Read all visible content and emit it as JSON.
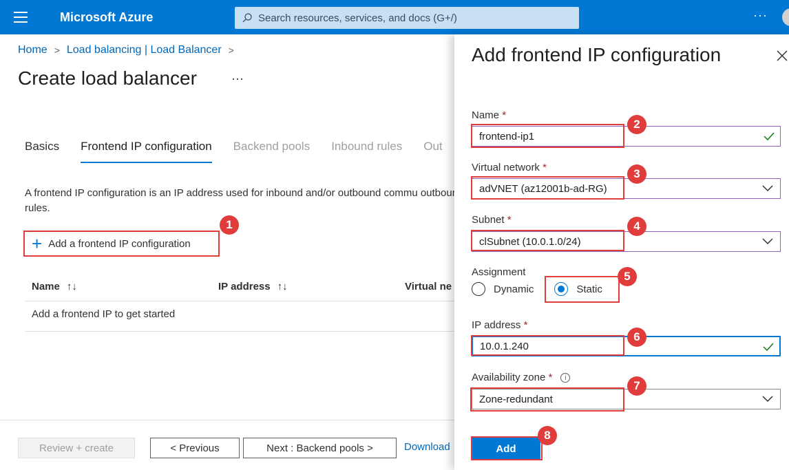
{
  "topbar": {
    "brand": "Microsoft Azure",
    "search_placeholder": "Search resources, services, and docs (G+/)",
    "more": "···"
  },
  "breadcrumb": {
    "home": "Home",
    "load_balancing": "Load balancing | Load Balancer"
  },
  "page": {
    "title": "Create load balancer",
    "more": "···"
  },
  "tabs": [
    {
      "label": "Basics"
    },
    {
      "label": "Frontend IP configuration"
    },
    {
      "label": "Backend pools"
    },
    {
      "label": "Inbound rules"
    },
    {
      "label": "Out"
    }
  ],
  "description": "A frontend IP configuration is an IP address used for inbound and/or outbound commu outbound rules.",
  "add_frontend_label": "Add a frontend IP configuration",
  "table": {
    "columns": [
      {
        "label": "Name",
        "sort": "↑↓"
      },
      {
        "label": "IP address",
        "sort": "↑↓"
      },
      {
        "label": "Virtual ne"
      }
    ],
    "empty_text": "Add a frontend IP to get started"
  },
  "footer": {
    "review_create": "Review + create",
    "previous": "< Previous",
    "next": "Next : Backend pools >",
    "download": "Download"
  },
  "panel": {
    "title": "Add frontend IP configuration",
    "name_label": "Name",
    "name_value": "frontend-ip1",
    "vnet_label": "Virtual network",
    "vnet_value": "adVNET (az12001b-ad-RG)",
    "subnet_label": "Subnet",
    "subnet_value": "clSubnet (10.0.1.0/24)",
    "assignment_label": "Assignment",
    "assignment_options": [
      "Dynamic",
      "Static"
    ],
    "assignment_selected": "Static",
    "ip_label": "IP address",
    "ip_value": "10.0.1.240",
    "zone_label": "Availability zone",
    "zone_value": "Zone-redundant",
    "required_mark": "*",
    "info_mark": "i",
    "add_button": "Add"
  },
  "step_badges": [
    "1",
    "2",
    "3",
    "4",
    "5",
    "6",
    "7",
    "8"
  ],
  "colors": {
    "azure_blue": "#0078d4",
    "highlight_red": "#e03c3c",
    "valid_check": "#107c10"
  }
}
